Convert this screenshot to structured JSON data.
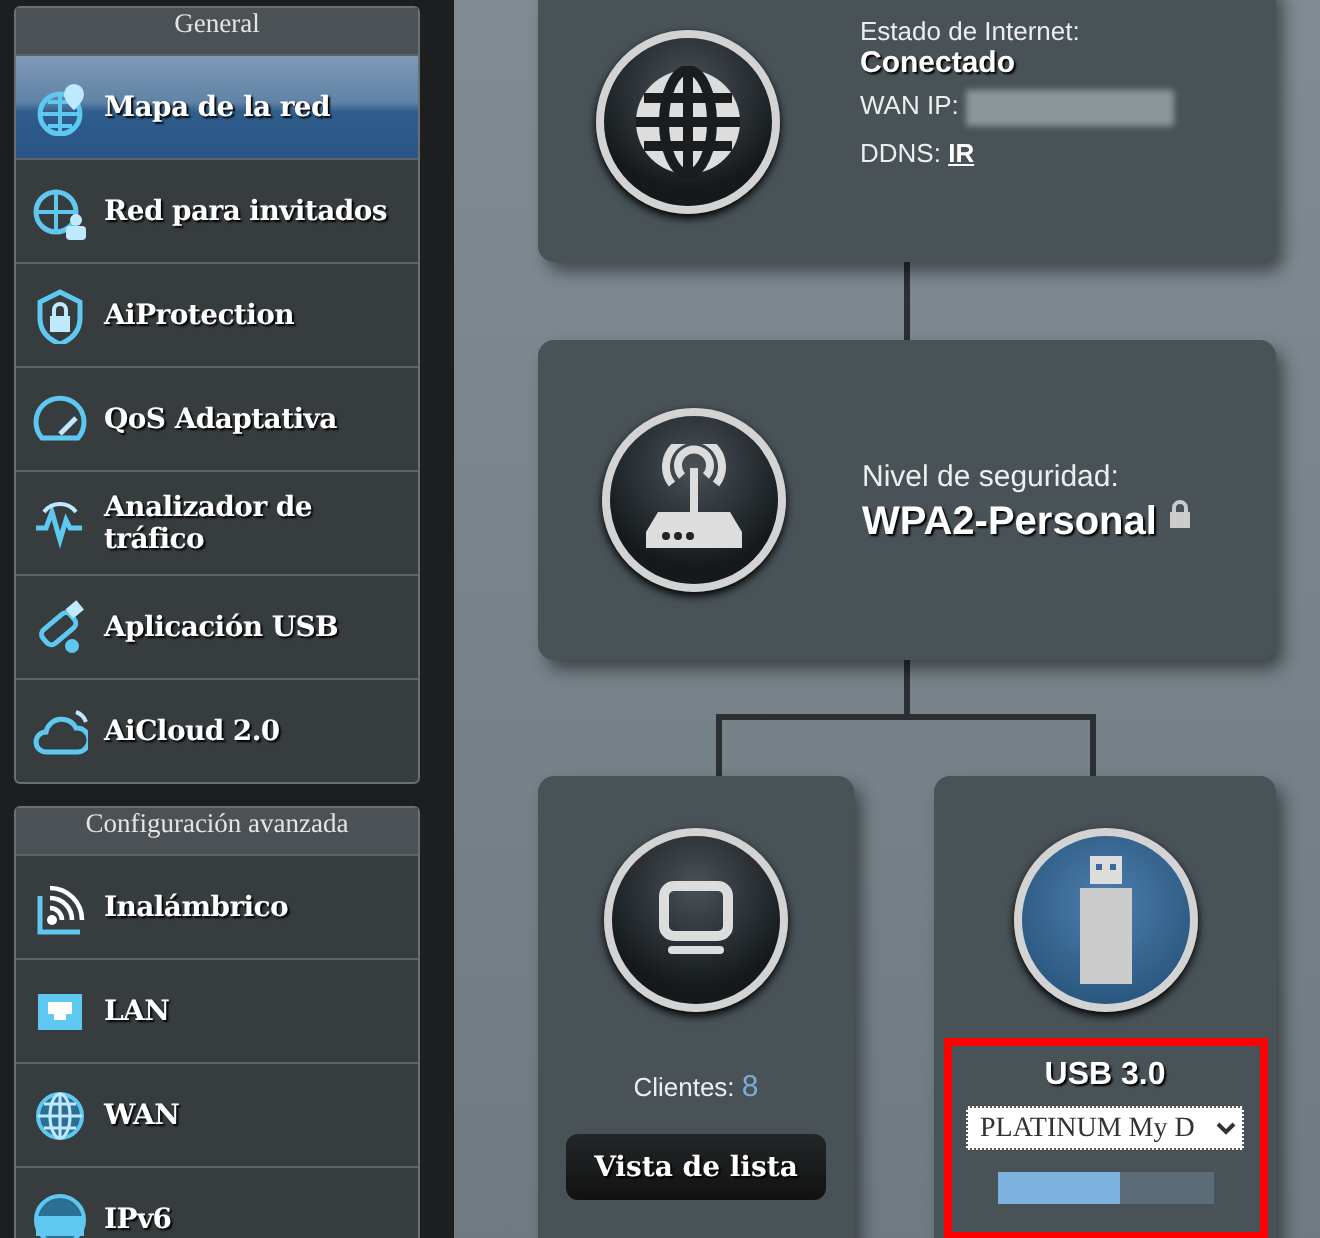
{
  "sidebar": {
    "groups": [
      {
        "title": "General",
        "items": [
          {
            "label": "Mapa de la red",
            "selected": true
          },
          {
            "label": "Red para invitados",
            "selected": false
          },
          {
            "label": "AiProtection",
            "selected": false
          },
          {
            "label": "QoS Adaptativa",
            "selected": false
          },
          {
            "label": "Analizador de tráfico",
            "selected": false
          },
          {
            "label": "Aplicación USB",
            "selected": false
          },
          {
            "label": "AiCloud 2.0",
            "selected": false
          }
        ]
      },
      {
        "title": "Configuración avanzada",
        "items": [
          {
            "label": "Inalámbrico",
            "selected": false
          },
          {
            "label": "LAN",
            "selected": false
          },
          {
            "label": "WAN",
            "selected": false
          },
          {
            "label": "IPv6",
            "selected": false
          }
        ]
      }
    ]
  },
  "internet": {
    "status_label": "Estado de Internet:",
    "status": "Conectado",
    "wan_ip_label": "WAN IP:",
    "ddns_label": "DDNS:",
    "ddns_link": "IR"
  },
  "router": {
    "security_label": "Nivel de seguridad:",
    "security": "WPA2-Personal"
  },
  "clients": {
    "label": "Clientes:",
    "count": "8",
    "button": "Vista de lista"
  },
  "usb": {
    "title": "USB 3.0",
    "device": "PLATINUM My D",
    "level": 0.57,
    "highlighted": true
  }
}
